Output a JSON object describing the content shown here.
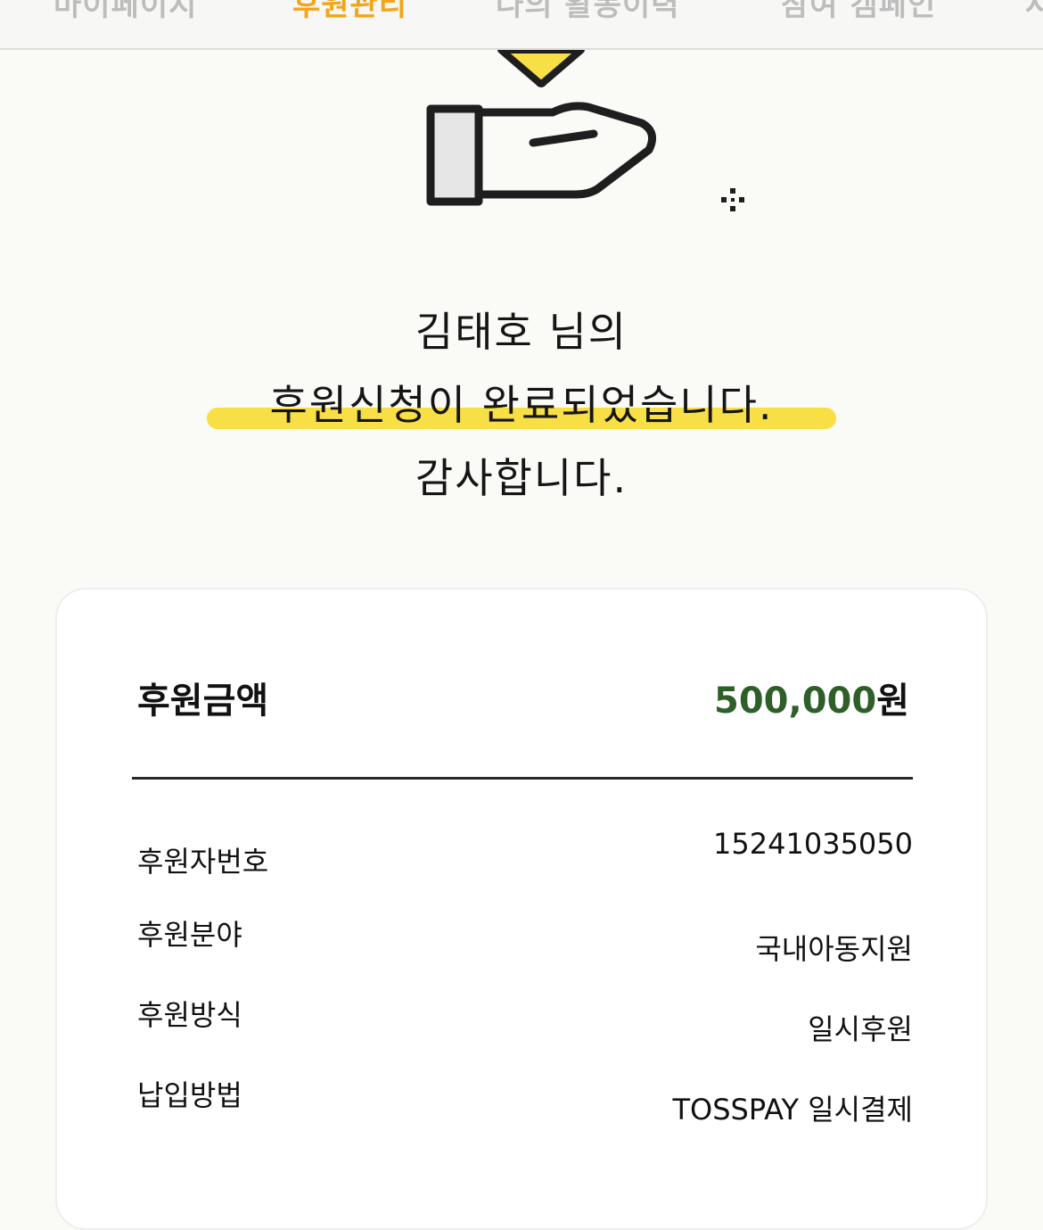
{
  "tabs": [
    {
      "label": "마이페이지",
      "active": false
    },
    {
      "label": "후원관리",
      "active": true
    },
    {
      "label": "나의 활동이력",
      "active": false
    },
    {
      "label": "참여 캠페인",
      "active": false
    },
    {
      "label": "사",
      "active": false
    }
  ],
  "colors": {
    "accent_tab": "#f3a41c",
    "highlight": "#f8df45",
    "amount": "#2f5f29"
  },
  "message": {
    "line1": "김태호 님의",
    "line2": "후원신청이 완료되었습니다.",
    "line3": "감사합니다."
  },
  "summary": {
    "amount_label": "후원금액",
    "amount_number": "500,000",
    "amount_unit": "원",
    "rows": [
      {
        "label": "후원자번호",
        "value": "15241035050"
      },
      {
        "label": "후원분야",
        "value": "국내아동지원"
      },
      {
        "label": "후원방식",
        "value": "일시후원"
      },
      {
        "label": "납입방법",
        "value": "TOSSPAY 일시결제"
      }
    ]
  },
  "icons": [
    "heart-icon",
    "giving-hand-icon",
    "sparkle-icon"
  ]
}
